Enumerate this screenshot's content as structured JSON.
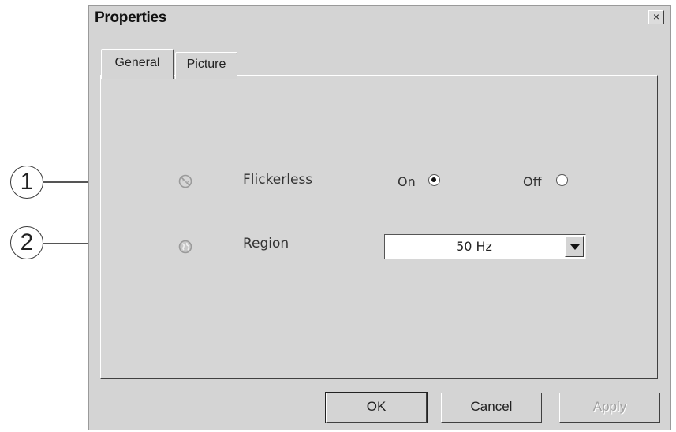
{
  "window": {
    "title": "Properties",
    "close_glyph": "×"
  },
  "tabs": [
    {
      "label": "General",
      "active": true
    },
    {
      "label": "Picture",
      "active": false
    }
  ],
  "general": {
    "flickerless": {
      "label": "Flickerless",
      "icon": "flickerless-icon",
      "on_label": "On",
      "off_label": "Off",
      "selected": "On"
    },
    "region": {
      "label": "Region",
      "icon": "globe-icon",
      "value": "50 Hz"
    }
  },
  "buttons": {
    "ok": "OK",
    "cancel": "Cancel",
    "apply": "Apply"
  },
  "callouts": [
    "1",
    "2"
  ]
}
